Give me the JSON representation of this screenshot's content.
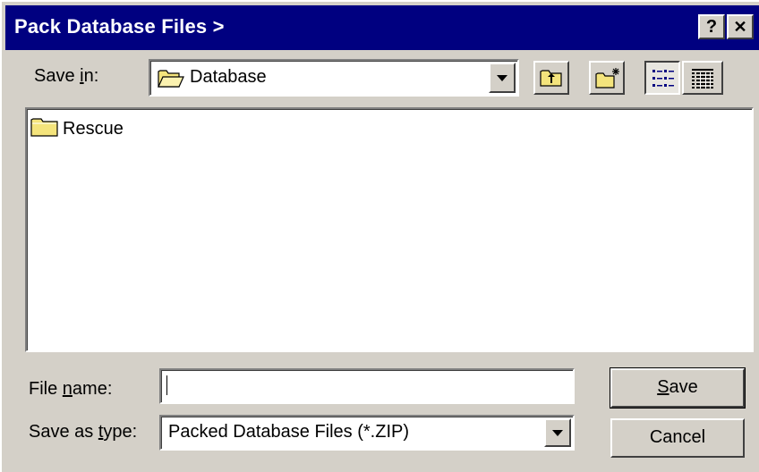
{
  "window": {
    "title": "Pack Database Files >",
    "help_glyph": "?",
    "close_glyph": "✕"
  },
  "save_in": {
    "label_pre": "Save ",
    "label_ul": "i",
    "label_post": "n:",
    "value": "Database",
    "icon": "folder-open-icon"
  },
  "toolbar": {
    "up_folder_icon": "up-one-level-icon",
    "new_folder_icon": "new-folder-icon",
    "list_view_icon": "list-view-icon",
    "details_view_icon": "details-view-icon"
  },
  "files": [
    {
      "name": "Rescue",
      "icon": "folder-icon"
    }
  ],
  "file_name": {
    "label_pre": "File ",
    "label_ul": "n",
    "label_post": "ame:",
    "value": ""
  },
  "save_as_type": {
    "label_pre": "Save as ",
    "label_ul": "t",
    "label_post": "ype:",
    "value": "Packed Database Files (*.ZIP)"
  },
  "buttons": {
    "save_ul": "S",
    "save_post": "ave",
    "cancel": "Cancel"
  },
  "colors": {
    "titlebar": "#000080",
    "face": "#d4d0c8",
    "folder": "#f4e47c"
  }
}
